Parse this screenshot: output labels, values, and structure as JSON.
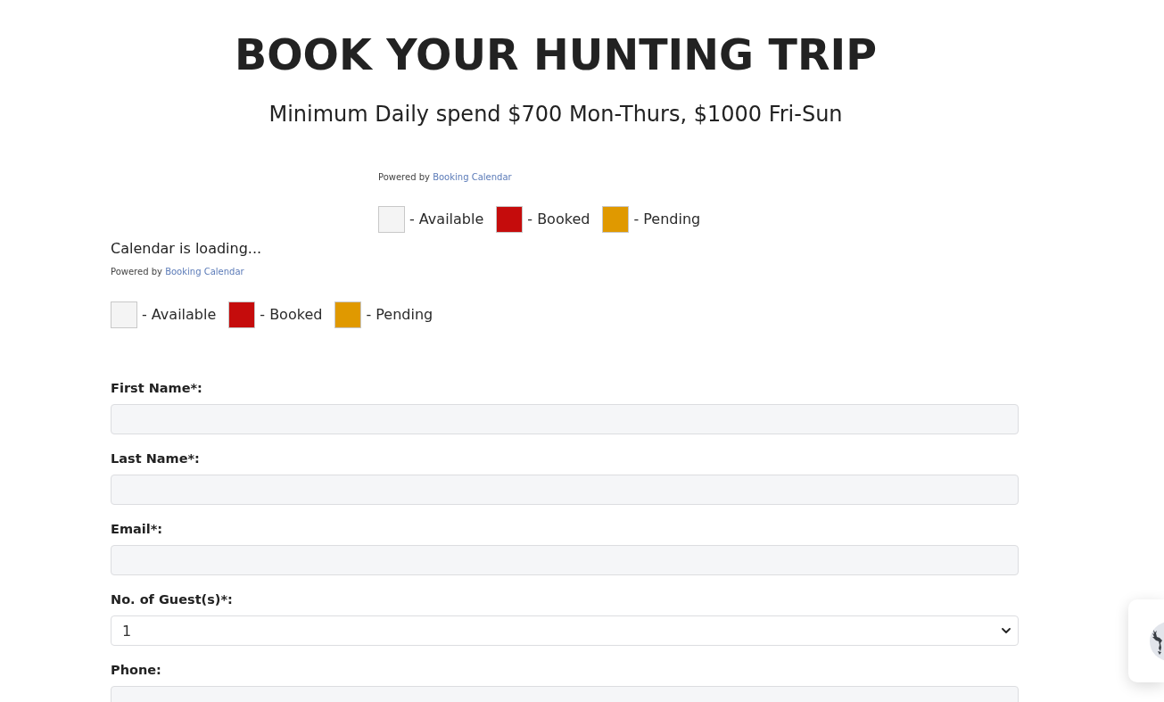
{
  "title": "BOOK YOUR HUNTING TRIP",
  "subtitle": "Minimum Daily spend $700 Mon-Thurs, $1000 Fri-Sun",
  "calendar_blocks": [
    {
      "kind": "centered",
      "powered_by": "Powered by",
      "link": "Booking Calendar",
      "legend": [
        {
          "label": "- Available",
          "color": "#f4f4f4"
        },
        {
          "label": "- Booked",
          "color": "#c50c0c"
        },
        {
          "label": "- Pending",
          "color": "#e09900"
        }
      ]
    },
    {
      "kind": "full",
      "loading_text": "Calendar is loading...",
      "powered_by": "Powered by",
      "link": "Booking Calendar",
      "legend": [
        {
          "label": "- Available",
          "color": "#f4f4f4"
        },
        {
          "label": "- Booked",
          "color": "#c50c0c"
        },
        {
          "label": "- Pending",
          "color": "#e09900"
        }
      ]
    }
  ],
  "form_fields": [
    {
      "label": "First Name*:",
      "kind": "text"
    },
    {
      "label": "Last Name*:",
      "kind": "text"
    },
    {
      "label": "Email*:",
      "kind": "text"
    },
    {
      "label": "No. of Guest(s)*:",
      "kind": "select",
      "value": "1"
    },
    {
      "label": "Phone:",
      "kind": "text"
    }
  ]
}
